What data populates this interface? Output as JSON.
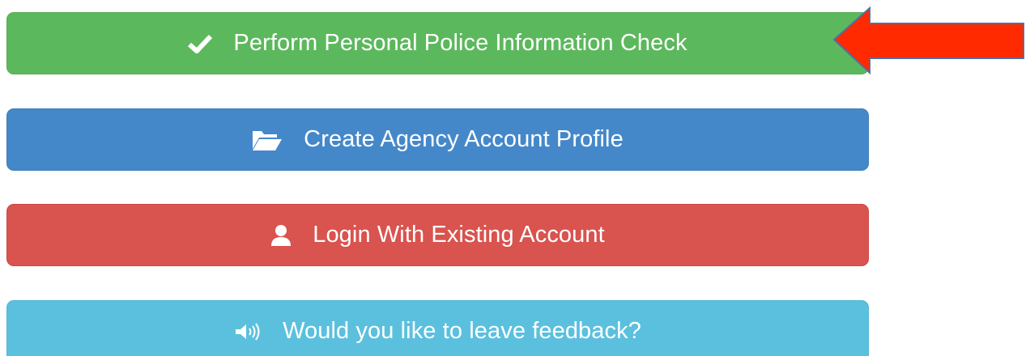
{
  "buttons": {
    "police_check": {
      "label": "Perform Personal Police Information Check",
      "icon": "checkmark-icon",
      "color": "#5cb85c"
    },
    "create_agency": {
      "label": "Create Agency Account Profile",
      "icon": "folder-open-icon",
      "color": "#4588ca"
    },
    "login": {
      "label": "Login With Existing Account",
      "icon": "user-icon",
      "color": "#d9534f"
    },
    "feedback": {
      "label": "Would you like to leave feedback?",
      "icon": "speaker-icon",
      "color": "#5bc0de"
    }
  },
  "annotation": {
    "arrow_color": "#ff2a00",
    "arrow_icon": "red-arrow-pointing-left"
  }
}
